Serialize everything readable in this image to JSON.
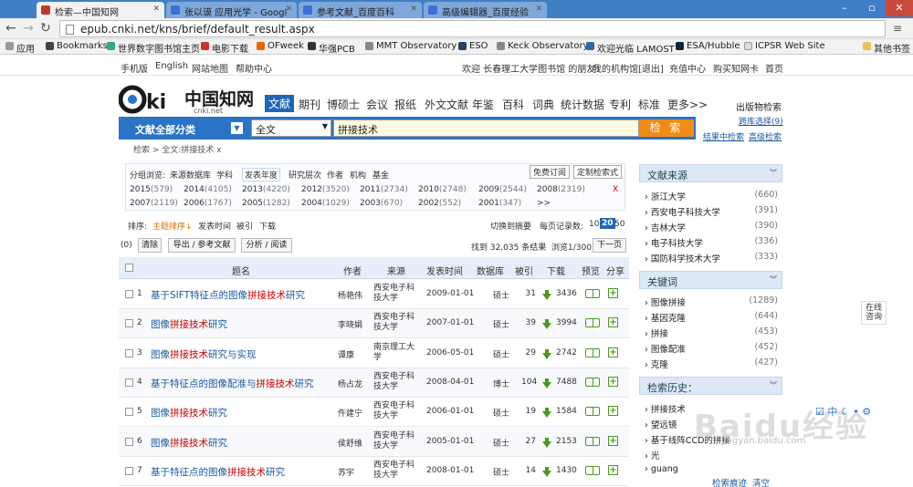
{
  "browser": {
    "tabs": [
      {
        "label": "检索—中国知网",
        "color": "#c0392b"
      },
      {
        "label": "张以谟 应用光学 - Googl",
        "color": "#3b6fd6"
      },
      {
        "label": "参考文献_百度百科",
        "color": "#3b6fd6"
      },
      {
        "label": "高级编辑器_百度经验",
        "color": "#3b6fd6"
      }
    ],
    "url": "epub.cnki.net/kns/brief/default_result.aspx",
    "bookmarks": [
      "应用",
      "Bookmarks",
      "世界数字图书馆主页",
      "电影下载",
      "OFweek",
      "华强PCB",
      "MMT Observatory",
      "ESO",
      "Keck Observatory",
      "欢迎光临 LAMOST",
      "ESA/Hubble",
      "ICPSR Web Site",
      "其他书签"
    ]
  },
  "toplinks": {
    "left": [
      "手机版",
      "English",
      "网站地图",
      "帮助中心"
    ],
    "welcome": "欢迎  长春理工大学图书馆 的朋友！",
    "right": [
      "我的机构馆",
      "[退出]",
      "充值中心",
      "购买知网卡",
      "首页"
    ]
  },
  "logo": {
    "text": "中国知网",
    "sub": "cnki.net"
  },
  "channels": [
    "文献",
    "期刊",
    "博硕士",
    "会议",
    "报纸",
    "外文文献",
    "年鉴",
    "百科",
    "词典",
    "统计数据",
    "专利",
    "标准",
    "更多>>"
  ],
  "search": {
    "category": "文献全部分类",
    "field": "全文",
    "query": "拼接技术",
    "button": "检 索",
    "right_links": [
      "出版物检索",
      "跨库选择(9)",
      "结果中检索",
      "高级检索"
    ]
  },
  "breadcrumb": "检索 > 全文:拼接技术  x",
  "filter": {
    "groups_label": "分组浏览:",
    "groups": [
      "来源数据库",
      "学科",
      "发表年度",
      "研究层次",
      "作者",
      "机构",
      "基金"
    ],
    "buttons": [
      "免费订阅",
      "定制检索式"
    ],
    "years_row1": [
      [
        "2015",
        "(579)"
      ],
      [
        "2014",
        "(4105)"
      ],
      [
        "2013",
        "(4220)"
      ],
      [
        "2012",
        "(3520)"
      ],
      [
        "2011",
        "(2734)"
      ],
      [
        "2010",
        "(2748)"
      ],
      [
        "2009",
        "(2544)"
      ],
      [
        "2008",
        "(2319)"
      ]
    ],
    "years_row2": [
      [
        "2007",
        "(2119)"
      ],
      [
        "2006",
        "(1767)"
      ],
      [
        "2005",
        "(1282)"
      ],
      [
        "2004",
        "(1029)"
      ],
      [
        "2003",
        "(670)"
      ],
      [
        "2002",
        "(552)"
      ],
      [
        "2001",
        "(347)"
      ],
      [
        ">>",
        ""
      ]
    ],
    "close": "X"
  },
  "sortbar": {
    "label": "排序:",
    "items": [
      "主题排序",
      "发表时间",
      "被引",
      "下载"
    ],
    "summary_switch": "切换到摘要",
    "per_page_label": "每页记录数:",
    "per_page": [
      "10",
      "20",
      "50"
    ]
  },
  "actions": {
    "selected": "(0)",
    "clear": "清除",
    "export": "导出 / 参考文献",
    "analyze": "分析 / 阅读",
    "result_count": "找到 32,035 条结果",
    "pages": "浏览1/300",
    "next": "下一页"
  },
  "table": {
    "headers": [
      "题名",
      "作者",
      "来源",
      "发表时间",
      "数据库",
      "被引",
      "下载",
      "预览",
      "分享"
    ],
    "rows": [
      {
        "n": "1",
        "pre": "基于SIFT特征点的图像",
        "hl": "拼接技术",
        "post": "研究",
        "author": "杨艳伟",
        "source": "西安电子科技大学",
        "date": "2009-01-01",
        "db": "硕士",
        "cited": "31",
        "dl": "3436"
      },
      {
        "n": "2",
        "pre": "图像",
        "hl": "拼接技术",
        "post": "研究",
        "author": "李晓娟",
        "source": "西安电子科技大学",
        "date": "2007-01-01",
        "db": "硕士",
        "cited": "39",
        "dl": "3994"
      },
      {
        "n": "3",
        "pre": "图像",
        "hl": "拼接技术",
        "post": "研究与实现",
        "author": "谭康",
        "source": "南京理工大学",
        "date": "2006-05-01",
        "db": "硕士",
        "cited": "29",
        "dl": "2742"
      },
      {
        "n": "4",
        "pre": "基于特征点的图像配准与",
        "hl": "拼接技术",
        "post": "研究",
        "author": "杨占龙",
        "source": "西安电子科技大学",
        "date": "2008-04-01",
        "db": "博士",
        "cited": "104",
        "dl": "7488"
      },
      {
        "n": "5",
        "pre": "图像",
        "hl": "拼接技术",
        "post": "研究",
        "author": "仵建宁",
        "source": "西安电子科技大学",
        "date": "2006-01-01",
        "db": "硕士",
        "cited": "19",
        "dl": "1584"
      },
      {
        "n": "6",
        "pre": "图像",
        "hl": "拼接技术",
        "post": "研究",
        "author": "侯舒维",
        "source": "西安电子科技大学",
        "date": "2005-01-01",
        "db": "硕士",
        "cited": "27",
        "dl": "2153"
      },
      {
        "n": "7",
        "pre": "基于特征点的图像",
        "hl": "拼接技术",
        "post": "研究",
        "author": "苏宇",
        "source": "西安电子科技大学",
        "date": "2008-01-01",
        "db": "硕士",
        "cited": "14",
        "dl": "1430"
      }
    ]
  },
  "sidebar": {
    "source": {
      "title": "文献来源",
      "items": [
        [
          "浙江大学",
          "(660)"
        ],
        [
          "西安电子科技大学",
          "(391)"
        ],
        [
          "吉林大学",
          "(390)"
        ],
        [
          "电子科技大学",
          "(336)"
        ],
        [
          "国防科学技术大学",
          "(333)"
        ]
      ]
    },
    "keywords": {
      "title": "关键词",
      "items": [
        [
          "图像拼接",
          "(1289)"
        ],
        [
          "基因克隆",
          "(644)"
        ],
        [
          "拼接",
          "(453)"
        ],
        [
          "图像配准",
          "(452)"
        ],
        [
          "克隆",
          "(427)"
        ]
      ]
    },
    "history": {
      "title": "检索历史：",
      "items": [
        "拼接技术",
        "望远镜",
        "基于线阵CCD的拼接",
        "光",
        "guang"
      ],
      "links": [
        "检索痕迹",
        "清空"
      ]
    }
  },
  "float": {
    "consult": "在线咨询"
  },
  "watermark": {
    "main": "Baidu经验",
    "sub": "jingyan.baidu.com"
  },
  "tray": {
    "text": "中"
  }
}
